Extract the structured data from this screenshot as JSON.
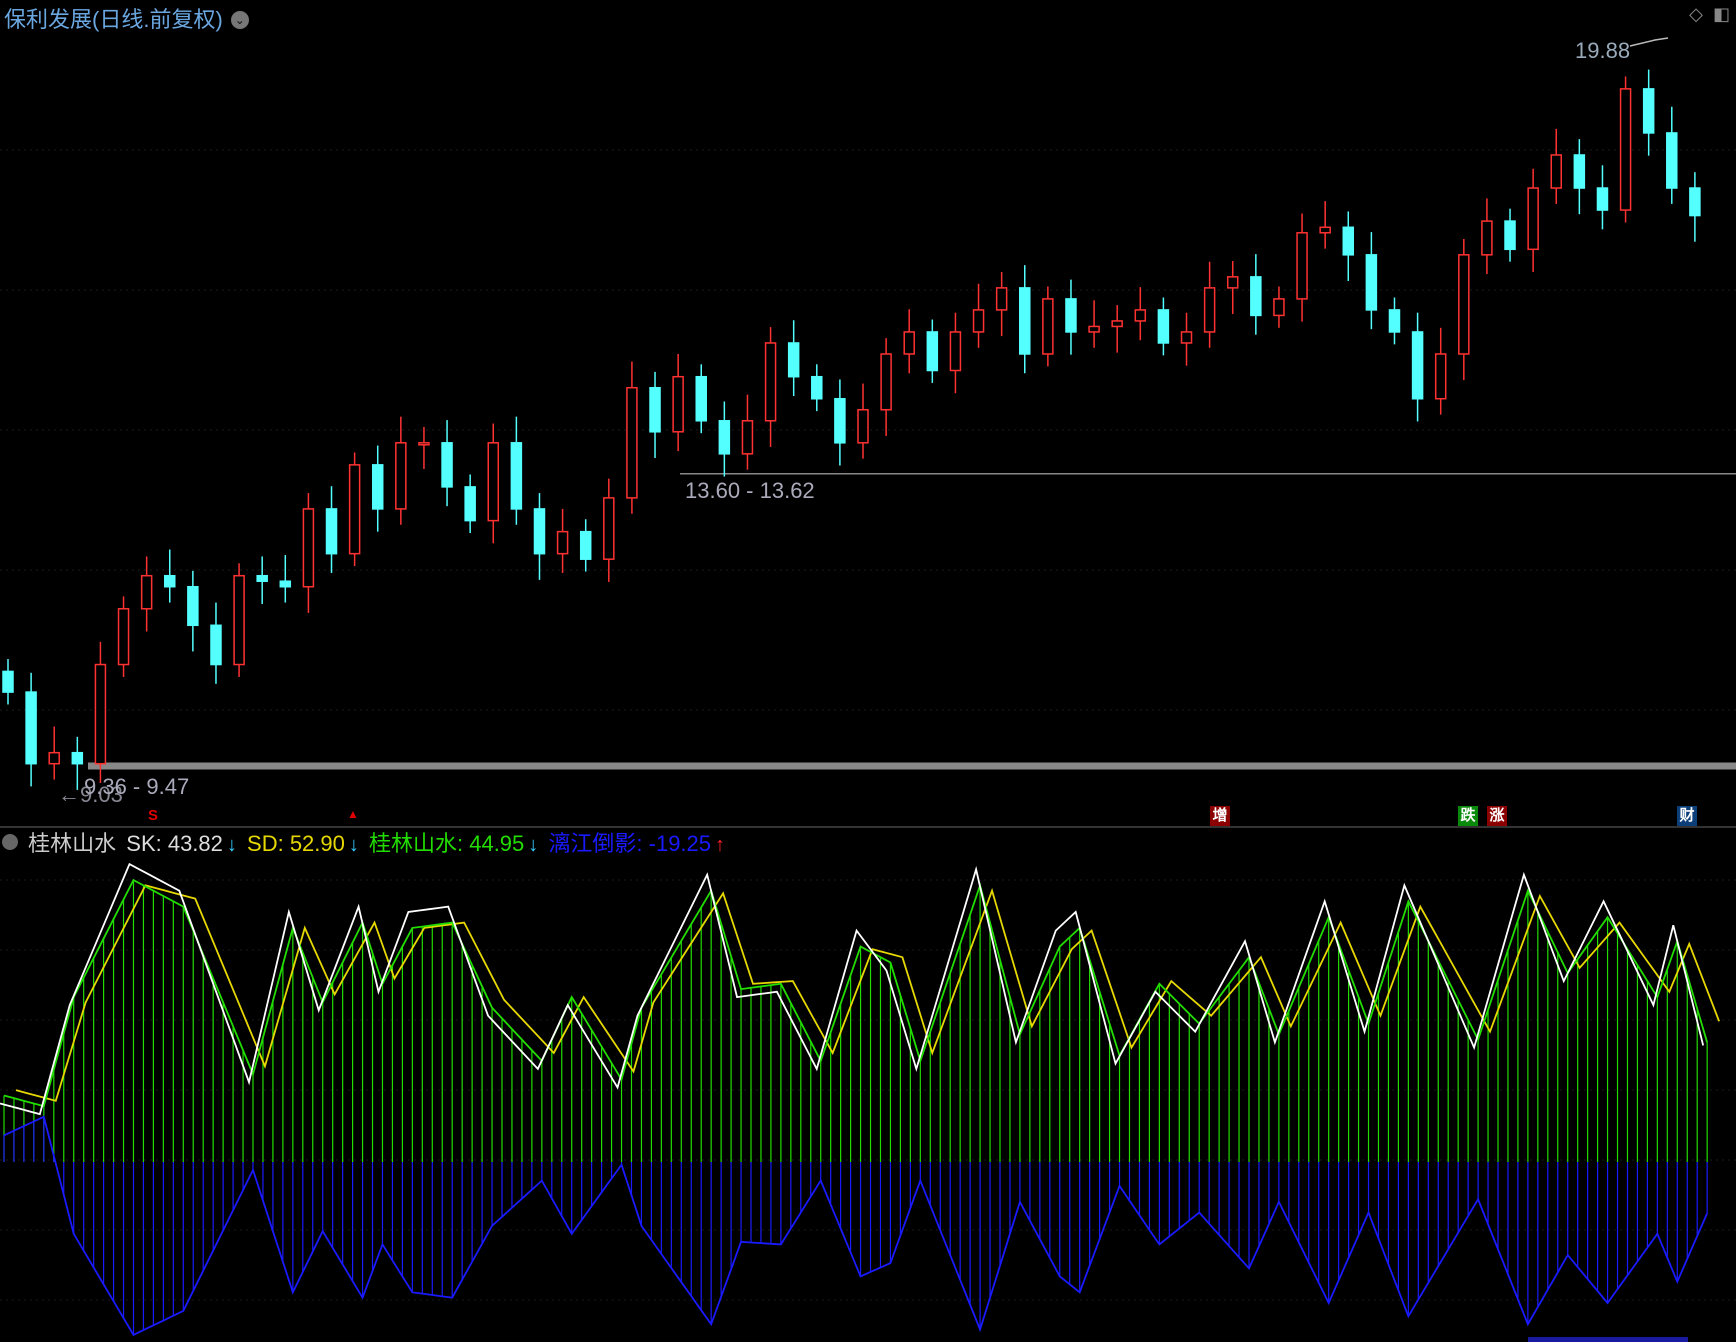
{
  "header": {
    "title": "保利发展(日线.前复权)",
    "chevron_icon": "chevron-down-icon",
    "icons": [
      "diamond-icon",
      "panel-toggle-icon"
    ]
  },
  "price_labels": {
    "high": "19.88",
    "range_mid": "13.60 - 13.62",
    "range_low": "9.36 - 9.47",
    "low": "←9.03"
  },
  "markers": [
    {
      "text": "S",
      "color": "#e00000"
    },
    {
      "text": "▲",
      "color": "#e00000"
    },
    {
      "text": "增",
      "color": "#8b0000"
    },
    {
      "text": "跌",
      "color": "#0a8a0a"
    },
    {
      "text": "涨",
      "color": "#8b0000"
    },
    {
      "text": "财",
      "color": "#0c3f7a"
    }
  ],
  "indicator": {
    "name": "桂林山水",
    "sk_label": "SK: 43.82",
    "sk_dir": "↓",
    "sd_label": "SD: 52.90",
    "sd_dir": "↓",
    "main_label": "桂林山水: 44.95",
    "main_dir": "↓",
    "reflect_label": "漓江倒影: -19.25",
    "reflect_dir": "↑",
    "colors": {
      "sk": "#ffffff",
      "sd": "#e6d800",
      "main": "#22dd00",
      "reflect": "#1a1aff"
    }
  },
  "chart_data": [
    {
      "type": "candlestick",
      "title": "保利发展 日线",
      "up_color": "#ff3232",
      "down_color": "#54ffff",
      "closes": [
        10.44,
        9.4,
        9.56,
        9.4,
        10.84,
        11.65,
        12.13,
        11.97,
        11.41,
        10.84,
        12.13,
        12.05,
        11.97,
        13.1,
        12.45,
        13.74,
        13.1,
        14.06,
        14.06,
        13.42,
        12.93,
        14.06,
        13.1,
        12.45,
        12.77,
        12.37,
        13.26,
        14.86,
        14.22,
        15.02,
        14.38,
        13.9,
        14.38,
        15.51,
        15.02,
        14.7,
        14.06,
        14.54,
        15.35,
        15.67,
        15.11,
        15.67,
        15.99,
        16.31,
        15.35,
        16.15,
        15.67,
        15.75,
        15.83,
        15.99,
        15.51,
        15.67,
        16.31,
        16.47,
        15.91,
        16.15,
        17.11,
        17.19,
        16.79,
        15.99,
        15.67,
        14.7,
        15.35,
        16.79,
        17.28,
        16.87,
        17.76,
        18.24,
        17.76,
        17.44,
        19.2,
        18.56,
        17.76,
        17.36
      ],
      "support_levels": [
        13.61,
        9.42
      ]
    },
    {
      "type": "line",
      "title": "桂林山水",
      "bar_count": 172,
      "idx": [
        0,
        4,
        7,
        13,
        18,
        25,
        29,
        32,
        36,
        38,
        41,
        45,
        49,
        54,
        57,
        62,
        64,
        71,
        74,
        78,
        82,
        86,
        89,
        92,
        98,
        102,
        106,
        108,
        112,
        116,
        120,
        125,
        128,
        133,
        137,
        141,
        148,
        153,
        157,
        161,
        166,
        168,
        171
      ],
      "main": [
        25,
        21,
        62,
        106,
        96,
        33,
        88,
        60,
        90,
        67,
        88,
        90,
        58,
        38,
        62,
        31,
        58,
        102,
        65,
        67,
        38,
        81,
        75,
        38,
        104,
        48,
        81,
        88,
        40,
        67,
        52,
        77,
        48,
        92,
        52,
        98,
        46,
        102,
        71,
        92,
        62,
        83,
        44.95
      ],
      "sk": [
        22,
        18,
        59,
        112,
        102,
        30,
        94,
        57,
        96,
        64,
        94,
        96,
        55,
        35,
        59,
        28,
        55,
        108,
        62,
        64,
        35,
        87,
        72,
        35,
        110,
        45,
        87,
        94,
        37,
        64,
        49,
        83,
        45,
        98,
        49,
        104,
        43,
        108,
        68,
        98,
        59,
        89,
        43.82
      ],
      "sd": [
        27,
        23,
        60,
        104,
        99,
        36,
        88,
        63,
        90,
        69,
        88,
        90,
        61,
        41,
        62,
        34,
        60,
        101,
        67,
        68,
        41,
        80,
        77,
        41,
        102,
        51,
        80,
        87,
        43,
        68,
        55,
        77,
        51,
        90,
        55,
        96,
        49,
        100,
        73,
        90,
        64,
        82,
        52.9
      ],
      "reflect": [
        10,
        17,
        -27,
        -65,
        -56,
        -3,
        -49,
        -26,
        -51,
        -31,
        -49,
        -51,
        -24,
        -7,
        -27,
        -1,
        -24,
        -61,
        -30,
        -31,
        -7,
        -43,
        -38,
        -7,
        -63,
        -15,
        -43,
        -49,
        -9,
        -31,
        -19,
        -40,
        -15,
        -53,
        -19,
        -58,
        -14,
        -61,
        -35,
        -53,
        -27,
        -45,
        -19.25
      ]
    }
  ]
}
